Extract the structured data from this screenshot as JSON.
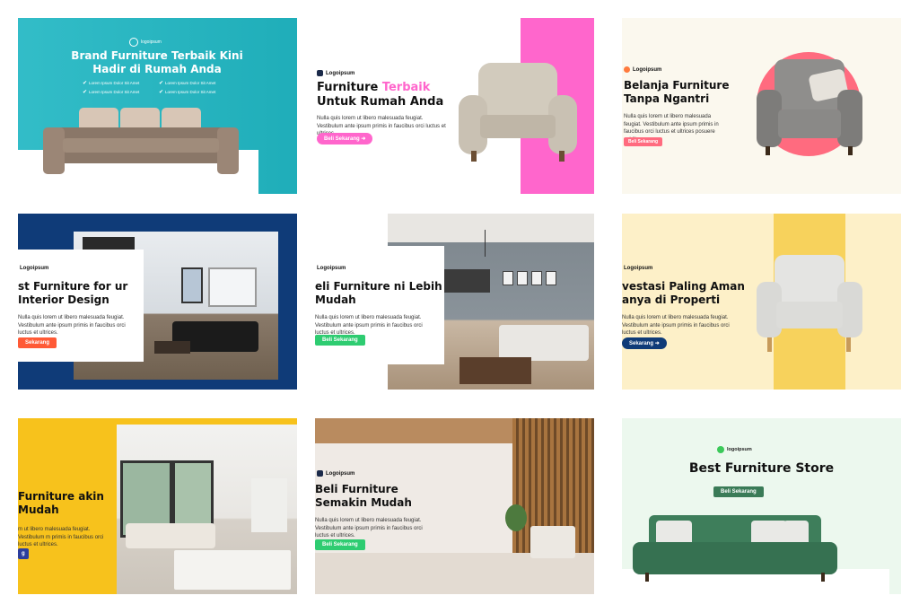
{
  "cards": [
    {
      "title": "Brand Furniture Terbaik Kini Hadir di Rumah Anda",
      "checks": [
        "Lorem Ipsum Dolor Sit Amet",
        "Lorem Ipsum Dolor Sit Amet",
        "Lorem Ipsum Dolor Sit Amet",
        "Lorem Ipsum Dolor Sit Amet"
      ],
      "logo": "logoipsum",
      "colors": {
        "bg": "#21b7c3"
      }
    },
    {
      "logo": "Logoipsum",
      "title_a": "Furniture ",
      "title_accent": "Terbaik",
      "title_b": "Untuk Rumah Anda",
      "desc": "Nulla quis lorem ut libero malesuada feugiat. Vestibulum ante ipsum primis in faucibus orci luctus et ultrices.",
      "button": "Beli Sekarang",
      "colors": {
        "accent": "#ff66cc"
      }
    },
    {
      "logo": "Logoipsum",
      "title": "Belanja Furniture Tanpa Ngantri",
      "desc": "Nulla quis lorem ut libero malesuada feugiat. Vestibulum ante ipsum primis in faucibus orci luctus et ultrices posuere cubilia",
      "button": "Beli Sekarang",
      "colors": {
        "circle": "#ff6b7f",
        "bg": "#fbf8ee"
      }
    },
    {
      "logo": "Logoipsum",
      "title": "st Furniture for ur Interior Design",
      "desc": "Nulla quis lorem ut libero malesuada feugiat. Vestibulum ante ipsum primis in faucibus orci luctus et ultrices.",
      "button": "Sekarang",
      "colors": {
        "frame": "#0f3b78",
        "button": "#ff5a36"
      }
    },
    {
      "logo": "Logoipsum",
      "title": "eli Furniture ni Lebih Mudah",
      "desc": "Nulla quis lorem ut libero malesuada feugiat. Vestibulum ante ipsum primis in faucibus orci luctus et ultrices.",
      "button": "Beli Sekarang",
      "colors": {
        "button": "#2ecc71"
      }
    },
    {
      "logo": "Logoipsum",
      "title": "vestasi Paling Aman anya di Properti",
      "desc": "Nulla quis lorem ut libero malesuada feugiat. Vestibulum ante ipsum primis in faucibus orci luctus et ultrices.",
      "button": "Sekarang",
      "colors": {
        "bg": "#fdf0c8",
        "stripe": "#f7d25c",
        "button": "#0f3b78"
      }
    },
    {
      "title": "Furniture akin Mudah",
      "desc": "m ut libero malesuada feugiat. Vestibulum m primis in faucibus orci luctus et ultrices.",
      "button": "g",
      "colors": {
        "bg": "#f7c21c",
        "button": "#2c3e9e"
      }
    },
    {
      "logo": "Logoipsum",
      "title": "Beli Furniture Semakin Mudah",
      "desc": "Nulla quis lorem ut libero malesuada feugiat. Vestibulum ante ipsum primis in faucibus orci luctus et ultrices.",
      "button": "Beli Sekarang",
      "colors": {
        "button": "#2ecc71"
      }
    },
    {
      "logo": "logoipsum",
      "title": "Best Furniture Store",
      "button": "Beli Sekarang",
      "colors": {
        "bg": "#ecf8ee",
        "sofa": "#3a7b57"
      }
    }
  ]
}
